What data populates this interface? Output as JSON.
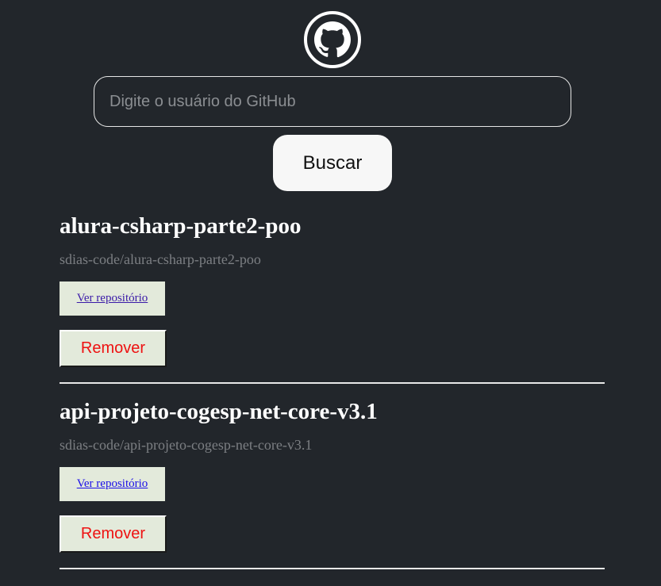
{
  "header": {
    "logo_icon": "github-octocat-icon"
  },
  "search": {
    "placeholder": "Digite o usuário do GitHub",
    "value": "",
    "button_label": "Buscar"
  },
  "repos": [
    {
      "name": "alura-csharp-parte2-poo",
      "full_name": "sdias-code/alura-csharp-parte2-poo",
      "link_label": "Ver repositório",
      "remove_label": "Remover",
      "visited": true
    },
    {
      "name": "api-projeto-cogesp-net-core-v3.1",
      "full_name": "sdias-code/api-projeto-cogesp-net-core-v3.1",
      "link_label": "Ver repositório",
      "remove_label": "Remover",
      "visited": false
    }
  ],
  "colors": {
    "background": "#22262b",
    "remove_text": "#ee1111",
    "card_button_bg": "#e3eadb"
  }
}
